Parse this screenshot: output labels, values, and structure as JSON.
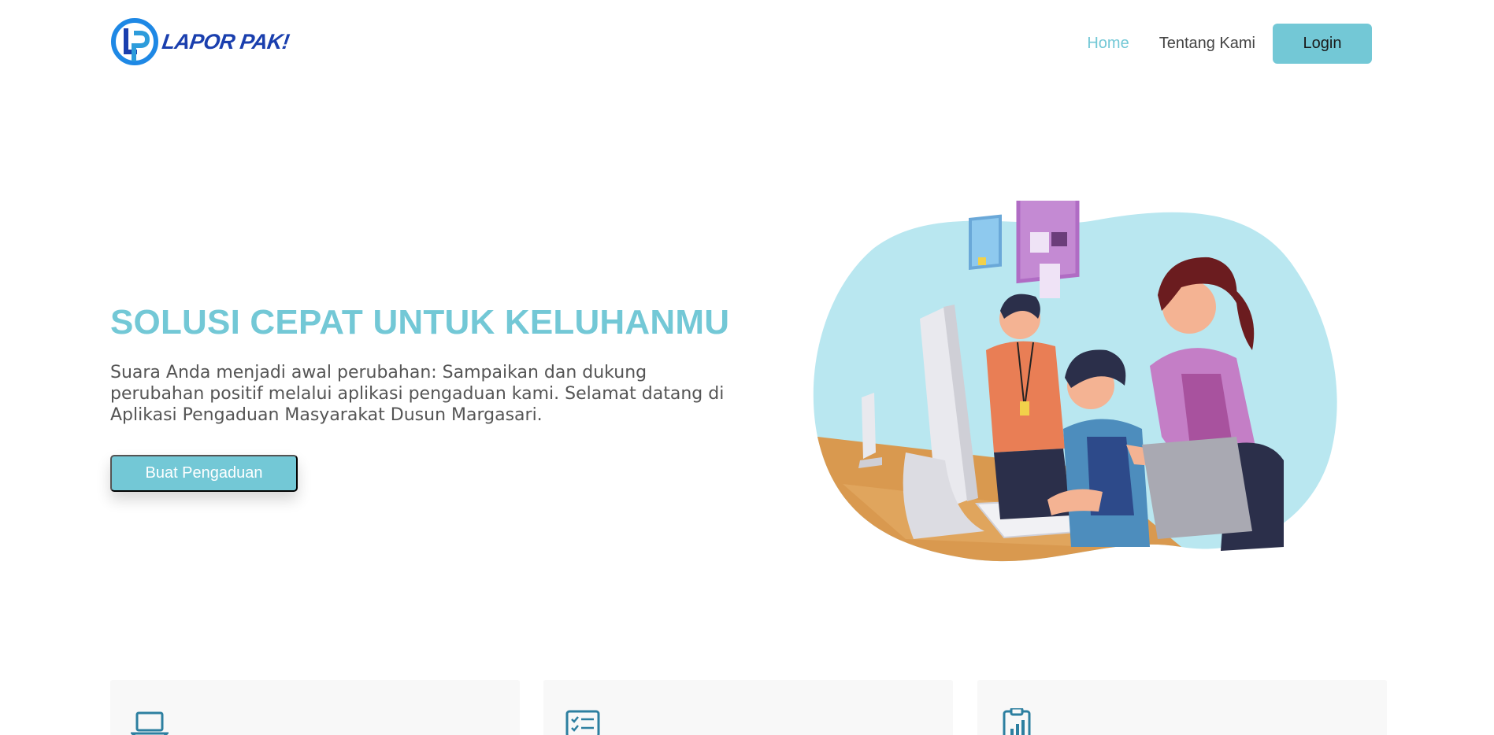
{
  "brand": {
    "name": "LAPOR PAK!",
    "accent": "#73c8d6",
    "logo_blue": "#1a3fae"
  },
  "nav": {
    "home": "Home",
    "about": "Tentang Kami",
    "login": "Login"
  },
  "hero": {
    "title": "SOLUSI CEPAT UNTUK KELUHANMU",
    "description": "Suara Anda menjadi awal perubahan: Sampaikan dan dukung perubahan positif melalui aplikasi pengaduan kami. Selamat datang di Aplikasi Pengaduan Masyarakat Dusun Margasari.",
    "cta": "Buat Pengaduan",
    "illustration": "people-at-computer-illustration"
  },
  "features": [
    {
      "icon": "laptop-icon"
    },
    {
      "icon": "checklist-icon"
    },
    {
      "icon": "clipboard-chart-icon"
    }
  ]
}
